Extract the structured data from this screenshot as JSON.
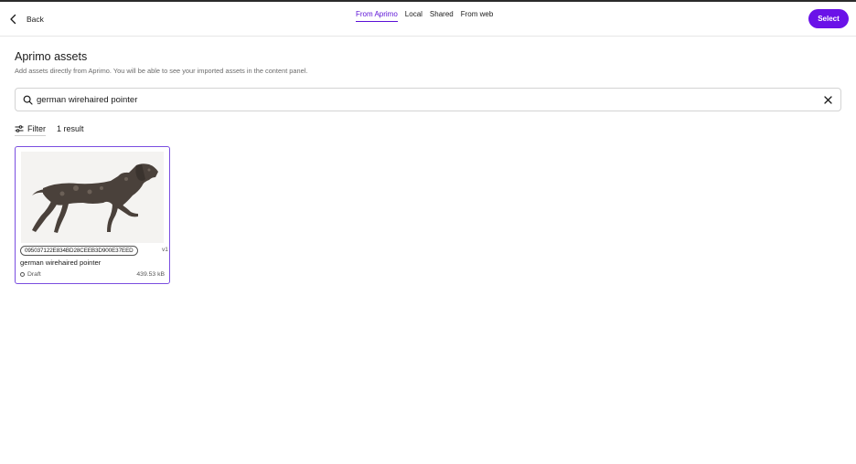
{
  "header": {
    "back_label": "Back",
    "tabs": [
      {
        "label": "From Aprimo",
        "active": true
      },
      {
        "label": "Local",
        "active": false
      },
      {
        "label": "Shared",
        "active": false
      },
      {
        "label": "From web",
        "active": false
      }
    ],
    "select_label": "Select"
  },
  "page": {
    "title": "Aprimo assets",
    "subtitle": "Add assets directly from Aprimo. You will be able to see your imported assets in the content panel."
  },
  "search": {
    "value": "german wirehaired pointer",
    "icon": "search-icon",
    "clear_icon": "close-icon"
  },
  "toolbar": {
    "filter_label": "Filter",
    "result_count": "1 result"
  },
  "results": [
    {
      "id": "095037122E834BD28CEEB3D900E37EED",
      "version": "v1",
      "name": "german wirehaired pointer",
      "status": "Draft",
      "size": "439.53 kB",
      "thumbnail": "dog-image"
    }
  ],
  "colors": {
    "accent": "#6a12e8",
    "tab_active": "#5b10d6",
    "card_border": "#7a4ee0"
  }
}
